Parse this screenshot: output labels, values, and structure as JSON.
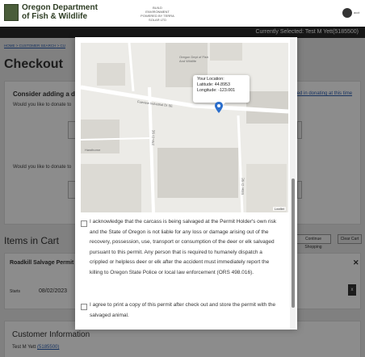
{
  "header": {
    "brand_line1": "Oregon Department",
    "brand_line2": "of Fish & Wildlife",
    "build_line1": "BUILD",
    "build_line2": "ENVIRONMENT",
    "build_line3": "POWERED BY TERRA SOLAR LTD",
    "user_label": "acct"
  },
  "selection_bar": {
    "text": "Currently Selected:   Test M Yett(5185500)"
  },
  "breadcrumb": {
    "home": "HOME",
    "sep": " > ",
    "customer_search": "CUSTOMER SEARCH",
    "sep2": " > ",
    "cu": "CU"
  },
  "page": {
    "title": "Checkout"
  },
  "donate": {
    "heading": "Consider adding a do",
    "line1": "Would you like to donate to",
    "line2": "Would you like to donate to",
    "side_link": "ted in donating at this time"
  },
  "cart": {
    "title": "Items in Cart",
    "continue_label": "Continue Shopping",
    "clear_label": "Clear Cart",
    "item_name": "Roadkill Salvage Permit",
    "starts_label": "Starts",
    "starts_value": "08/02/2023",
    "close_glyph": "✕",
    "remove_glyph": "x"
  },
  "customer": {
    "title": "Customer Information",
    "name": "Test M Yett",
    "id": "(5185500)"
  },
  "modal": {
    "popup_title": "Your Location:",
    "latitude_label": "Latitude: 44.8953",
    "longitude_label": "Longitude: -123.001",
    "leaflet": "Leaflet",
    "map_labels": {
      "odfw": "Oregon Dept of Fish And Wildlife",
      "road": "Fairview Industrial Dr SE",
      "street1": "27th Ct SE",
      "street2": "Hawthorne",
      "street3": "Bobby's Brewhouse",
      "street4": "Hillsboro",
      "street5": "Robert",
      "street6": "Elder Ct SE"
    },
    "ack1": "I acknowledge that the carcass is being salvaged at the Permit Holder's own risk and the State of Oregon is not liable for any loss or damage arising out of the recovery, possession, use, transport or consumption of the deer or elk salvaged pursuant to this permit. Any person that is required to humanely dispatch a crippled or helpless deer or elk after the accident must immediately report the killing to Oregon State Police or local law enforcement (ORS 498.016).",
    "ack2": "I agree to print a copy of this permit after check out and store the permit with the salvaged animal."
  },
  "colors": {
    "brand": "#2e3d24",
    "bar": "#2a2a2a",
    "link": "#2a5db0",
    "pin": "#2b6ecc"
  }
}
